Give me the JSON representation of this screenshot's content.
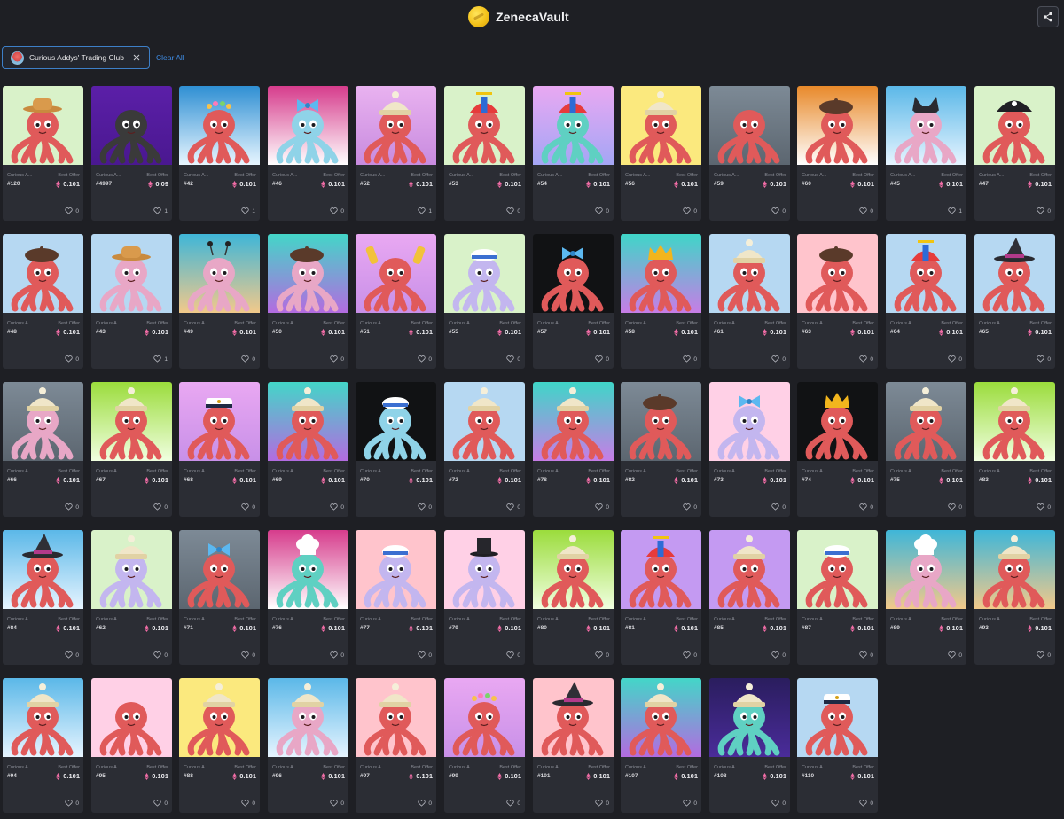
{
  "app": {
    "title": "ZenecaVault"
  },
  "header": {
    "logo_icon": "vault-coin-logo",
    "share_icon": "share-icon"
  },
  "filters": {
    "chip_label": "Curious Addys' Trading Club",
    "chip_avatar_icon": "collection-avatar",
    "chip_close_icon": "close-icon",
    "clear_all_label": "Clear All"
  },
  "card_labels": {
    "collection": "Curious A...",
    "best_offer": "Best Offer",
    "eth_icon": "eth-icon",
    "like_icon": "heart-icon"
  },
  "items": [
    {
      "id": "#120",
      "price": "0.101",
      "likes": "0",
      "bg": [
        "#d9f2c9",
        "#d9f2c9"
      ],
      "octo": "#e05a5a",
      "hat": "cowboy"
    },
    {
      "id": "#4997",
      "price": "0.09",
      "likes": "1",
      "bg": [
        "#5b1fa8",
        "#4a1890"
      ],
      "octo": "#3a3a3a",
      "hat": "none"
    },
    {
      "id": "#42",
      "price": "0.101",
      "likes": "1",
      "bg": [
        "#2f8fd3",
        "#e8f6ff"
      ],
      "octo": "#e05a5a",
      "hat": "flowers"
    },
    {
      "id": "#46",
      "price": "0.101",
      "likes": "0",
      "bg": [
        "#d63c8c",
        "#ffffff"
      ],
      "octo": "#8fd3e8",
      "hat": "bow"
    },
    {
      "id": "#52",
      "price": "0.101",
      "likes": "1",
      "bg": [
        "#e9b2f0",
        "#c88bdf"
      ],
      "octo": "#e05a5a",
      "hat": "beanie"
    },
    {
      "id": "#53",
      "price": "0.101",
      "likes": "0",
      "bg": [
        "#d9f2c9",
        "#d9f2c9"
      ],
      "octo": "#e05a5a",
      "hat": "propeller"
    },
    {
      "id": "#54",
      "price": "0.101",
      "likes": "0",
      "bg": [
        "#e9a8f2",
        "#a4a6f5"
      ],
      "octo": "#5fd0c2",
      "hat": "propeller"
    },
    {
      "id": "#56",
      "price": "0.101",
      "likes": "0",
      "bg": [
        "#fbe97e",
        "#fbe97e"
      ],
      "octo": "#e05a5a",
      "hat": "beanie"
    },
    {
      "id": "#59",
      "price": "0.101",
      "likes": "0",
      "bg": [
        "#7d8a96",
        "#5c6670"
      ],
      "octo": "#e05a5a",
      "hat": "none"
    },
    {
      "id": "#60",
      "price": "0.101",
      "likes": "0",
      "bg": [
        "#e8892a",
        "#ffffff"
      ],
      "octo": "#e05a5a",
      "hat": "beret"
    },
    {
      "id": "#45",
      "price": "0.101",
      "likes": "1",
      "bg": [
        "#5bb8e8",
        "#e6f4ff"
      ],
      "octo": "#e8a7c6",
      "hat": "cat"
    },
    {
      "id": "#47",
      "price": "0.101",
      "likes": "0",
      "bg": [
        "#d9f2c9",
        "#d9f2c9"
      ],
      "octo": "#e05a5a",
      "hat": "pirate"
    },
    {
      "id": "#48",
      "price": "0.101",
      "likes": "0",
      "bg": [
        "#b6d8f2",
        "#b6d8f2"
      ],
      "octo": "#e05a5a",
      "hat": "beret"
    },
    {
      "id": "#43",
      "price": "0.101",
      "likes": "1",
      "bg": [
        "#b6d8f2",
        "#b6d8f2"
      ],
      "octo": "#e8a7c6",
      "hat": "cowboy"
    },
    {
      "id": "#49",
      "price": "0.101",
      "likes": "0",
      "bg": [
        "#3fb6d8",
        "#f2c98a"
      ],
      "octo": "#e8a7c6",
      "hat": "antenna"
    },
    {
      "id": "#50",
      "price": "0.101",
      "likes": "0",
      "bg": [
        "#43d6c8",
        "#b36be0"
      ],
      "octo": "#e8a7c6",
      "hat": "beret"
    },
    {
      "id": "#51",
      "price": "0.101",
      "likes": "0",
      "bg": [
        "#e9a8f2",
        "#c890e8"
      ],
      "octo": "#e05a5a",
      "hat": "flippers"
    },
    {
      "id": "#55",
      "price": "0.101",
      "likes": "0",
      "bg": [
        "#d9f2c9",
        "#d9f2c9"
      ],
      "octo": "#c3b6ef",
      "hat": "sailor"
    },
    {
      "id": "#57",
      "price": "0.101",
      "likes": "0",
      "bg": [
        "#111214",
        "#111214"
      ],
      "octo": "#e05a5a",
      "hat": "bow"
    },
    {
      "id": "#58",
      "price": "0.101",
      "likes": "0",
      "bg": [
        "#3fd6c8",
        "#c77de6"
      ],
      "octo": "#e05a5a",
      "hat": "crown"
    },
    {
      "id": "#61",
      "price": "0.101",
      "likes": "0",
      "bg": [
        "#b6d8f2",
        "#b6d8f2"
      ],
      "octo": "#e05a5a",
      "hat": "beanie"
    },
    {
      "id": "#63",
      "price": "0.101",
      "likes": "0",
      "bg": [
        "#ffc4cc",
        "#ffc4cc"
      ],
      "octo": "#e05a5a",
      "hat": "beret"
    },
    {
      "id": "#64",
      "price": "0.101",
      "likes": "0",
      "bg": [
        "#b6d8f2",
        "#b6d8f2"
      ],
      "octo": "#e05a5a",
      "hat": "propeller"
    },
    {
      "id": "#65",
      "price": "0.101",
      "likes": "0",
      "bg": [
        "#b6d8f2",
        "#b6d8f2"
      ],
      "octo": "#e05a5a",
      "hat": "witch"
    },
    {
      "id": "#66",
      "price": "0.101",
      "likes": "0",
      "bg": [
        "#7d8a96",
        "#5c6670"
      ],
      "octo": "#e8a7c6",
      "hat": "beanie"
    },
    {
      "id": "#67",
      "price": "0.101",
      "likes": "0",
      "bg": [
        "#9bdc3c",
        "#f0ffe0"
      ],
      "octo": "#e05a5a",
      "hat": "beanie"
    },
    {
      "id": "#68",
      "price": "0.101",
      "likes": "0",
      "bg": [
        "#e9a8f2",
        "#c890e8"
      ],
      "octo": "#e05a5a",
      "hat": "captain"
    },
    {
      "id": "#69",
      "price": "0.101",
      "likes": "0",
      "bg": [
        "#43d6c8",
        "#b36be0"
      ],
      "octo": "#e05a5a",
      "hat": "beanie"
    },
    {
      "id": "#70",
      "price": "0.101",
      "likes": "0",
      "bg": [
        "#111214",
        "#111214"
      ],
      "octo": "#8fd3e8",
      "hat": "sailor"
    },
    {
      "id": "#72",
      "price": "0.101",
      "likes": "0",
      "bg": [
        "#b6d8f2",
        "#b6d8f2"
      ],
      "octo": "#e05a5a",
      "hat": "beanie"
    },
    {
      "id": "#78",
      "price": "0.101",
      "likes": "0",
      "bg": [
        "#3fd6c8",
        "#c77de6"
      ],
      "octo": "#e05a5a",
      "hat": "beanie"
    },
    {
      "id": "#82",
      "price": "0.101",
      "likes": "0",
      "bg": [
        "#7d8a96",
        "#5c6670"
      ],
      "octo": "#e05a5a",
      "hat": "beret"
    },
    {
      "id": "#73",
      "price": "0.101",
      "likes": "0",
      "bg": [
        "#ffd0e6",
        "#ffd0e6"
      ],
      "octo": "#c3b6ef",
      "hat": "bow"
    },
    {
      "id": "#74",
      "price": "0.101",
      "likes": "0",
      "bg": [
        "#111214",
        "#111214"
      ],
      "octo": "#e05a5a",
      "hat": "crown"
    },
    {
      "id": "#75",
      "price": "0.101",
      "likes": "0",
      "bg": [
        "#7d8a96",
        "#5c6670"
      ],
      "octo": "#e05a5a",
      "hat": "beanie"
    },
    {
      "id": "#83",
      "price": "0.101",
      "likes": "0",
      "bg": [
        "#9bdc3c",
        "#f0ffe0"
      ],
      "octo": "#e05a5a",
      "hat": "beanie"
    },
    {
      "id": "#84",
      "price": "0.101",
      "likes": "0",
      "bg": [
        "#5bb8e8",
        "#e6f4ff"
      ],
      "octo": "#e05a5a",
      "hat": "witch"
    },
    {
      "id": "#62",
      "price": "0.101",
      "likes": "0",
      "bg": [
        "#d9f2c9",
        "#d9f2c9"
      ],
      "octo": "#c3b6ef",
      "hat": "beanie"
    },
    {
      "id": "#71",
      "price": "0.101",
      "likes": "0",
      "bg": [
        "#7d8a96",
        "#5c6670"
      ],
      "octo": "#e05a5a",
      "hat": "bow"
    },
    {
      "id": "#76",
      "price": "0.101",
      "likes": "0",
      "bg": [
        "#d63c8c",
        "#ffffff"
      ],
      "octo": "#5fd0c2",
      "hat": "chef"
    },
    {
      "id": "#77",
      "price": "0.101",
      "likes": "0",
      "bg": [
        "#ffc4cc",
        "#ffc4cc"
      ],
      "octo": "#c3b6ef",
      "hat": "sailor"
    },
    {
      "id": "#79",
      "price": "0.101",
      "likes": "0",
      "bg": [
        "#ffd0e6",
        "#ffd0e6"
      ],
      "octo": "#c3b6ef",
      "hat": "tophat"
    },
    {
      "id": "#80",
      "price": "0.101",
      "likes": "0",
      "bg": [
        "#9bdc3c",
        "#f0ffe0"
      ],
      "octo": "#e05a5a",
      "hat": "beanie"
    },
    {
      "id": "#81",
      "price": "0.101",
      "likes": "0",
      "bg": [
        "#c49af2",
        "#c49af2"
      ],
      "octo": "#e05a5a",
      "hat": "propeller"
    },
    {
      "id": "#85",
      "price": "0.101",
      "likes": "0",
      "bg": [
        "#c49af2",
        "#c49af2"
      ],
      "octo": "#e05a5a",
      "hat": "beanie"
    },
    {
      "id": "#87",
      "price": "0.101",
      "likes": "0",
      "bg": [
        "#d9f2c9",
        "#d9f2c9"
      ],
      "octo": "#e05a5a",
      "hat": "sailor"
    },
    {
      "id": "#89",
      "price": "0.101",
      "likes": "0",
      "bg": [
        "#3fb6d8",
        "#f2c98a"
      ],
      "octo": "#e8a7c6",
      "hat": "chef"
    },
    {
      "id": "#93",
      "price": "0.101",
      "likes": "0",
      "bg": [
        "#3fb6d8",
        "#f2c98a"
      ],
      "octo": "#e05a5a",
      "hat": "beanie"
    },
    {
      "id": "#94",
      "price": "0.101",
      "likes": "0",
      "bg": [
        "#5bb8e8",
        "#e6f4ff"
      ],
      "octo": "#e05a5a",
      "hat": "beanie"
    },
    {
      "id": "#95",
      "price": "0.101",
      "likes": "0",
      "bg": [
        "#ffd0e6",
        "#ffd0e6"
      ],
      "octo": "#e05a5a",
      "hat": "none"
    },
    {
      "id": "#88",
      "price": "0.101",
      "likes": "0",
      "bg": [
        "#fbe97e",
        "#fbe97e"
      ],
      "octo": "#e05a5a",
      "hat": "beanie"
    },
    {
      "id": "#96",
      "price": "0.101",
      "likes": "0",
      "bg": [
        "#5bb8e8",
        "#e6f4ff"
      ],
      "octo": "#e8a7c6",
      "hat": "beanie"
    },
    {
      "id": "#97",
      "price": "0.101",
      "likes": "0",
      "bg": [
        "#ffc4cc",
        "#ffc4cc"
      ],
      "octo": "#e05a5a",
      "hat": "beanie"
    },
    {
      "id": "#99",
      "price": "0.101",
      "likes": "0",
      "bg": [
        "#e9a8f2",
        "#c890e8"
      ],
      "octo": "#e05a5a",
      "hat": "flowers"
    },
    {
      "id": "#101",
      "price": "0.101",
      "likes": "0",
      "bg": [
        "#ffc4cc",
        "#ffc4cc"
      ],
      "octo": "#e05a5a",
      "hat": "witch"
    },
    {
      "id": "#107",
      "price": "0.101",
      "likes": "0",
      "bg": [
        "#43d6c8",
        "#b36be0"
      ],
      "octo": "#e05a5a",
      "hat": "beanie"
    },
    {
      "id": "#108",
      "price": "0.101",
      "likes": "0",
      "bg": [
        "#2a1d5e",
        "#4a2c9a"
      ],
      "octo": "#5fd0c2",
      "hat": "beanie"
    },
    {
      "id": "#110",
      "price": "0.101",
      "likes": "0",
      "bg": [
        "#b6d8f2",
        "#b6d8f2"
      ],
      "octo": "#e05a5a",
      "hat": "captain"
    }
  ]
}
